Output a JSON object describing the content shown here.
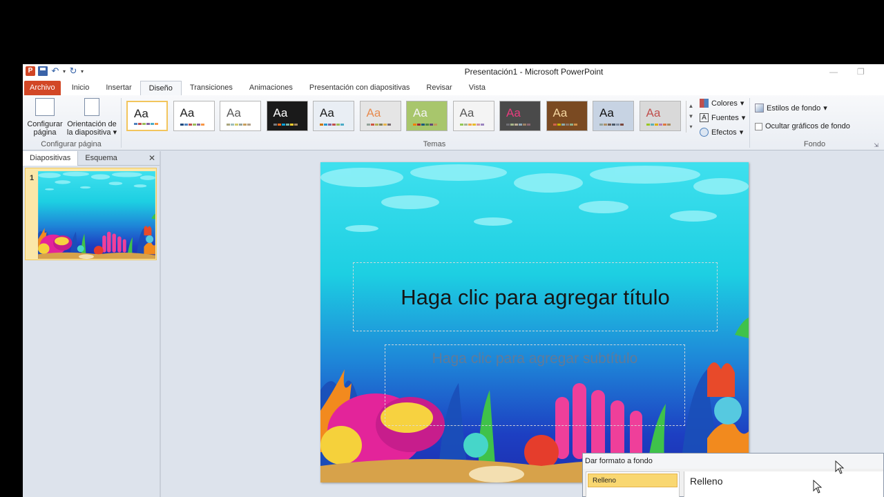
{
  "window": {
    "title": "Presentación1 - Microsoft PowerPoint"
  },
  "ribbon_tabs": [
    {
      "label": "Archivo",
      "type": "file"
    },
    {
      "label": "Inicio"
    },
    {
      "label": "Insertar"
    },
    {
      "label": "Diseño",
      "active": true
    },
    {
      "label": "Transiciones"
    },
    {
      "label": "Animaciones"
    },
    {
      "label": "Presentación con diapositivas"
    },
    {
      "label": "Revisar"
    },
    {
      "label": "Vista"
    }
  ],
  "page_setup": {
    "setup_label_1": "Configurar",
    "setup_label_2": "página",
    "orientation_label_1": "Orientación de",
    "orientation_label_2": "la diapositiva",
    "group_label": "Configurar página"
  },
  "themes": {
    "group_label": "Temas",
    "sample": "Aa",
    "items": [
      {
        "name": "office",
        "bg": "#ffffff",
        "fg": "#222222",
        "selected": true,
        "colors": [
          "#4f81bd",
          "#c0504d",
          "#9bbb59",
          "#8064a2",
          "#4bacc6",
          "#f79646"
        ]
      },
      {
        "name": "plain",
        "bg": "#ffffff",
        "fg": "#222222",
        "colors": [
          "#1f497d",
          "#4f81bd",
          "#c0504d",
          "#9bbb59",
          "#8064a2",
          "#f79646"
        ]
      },
      {
        "name": "adjacency",
        "bg": "#ffffff",
        "fg": "#5a5a5a",
        "colors": [
          "#a9a57c",
          "#9cbebd",
          "#d2cb6c",
          "#95a39d",
          "#c89f5d",
          "#b1a089"
        ]
      },
      {
        "name": "angles",
        "bg": "#1a1a1a",
        "fg": "#ffffff",
        "colors": [
          "#797b7e",
          "#f96a1b",
          "#08a1d9",
          "#7cb5a6",
          "#fbcf2e",
          "#a88963"
        ]
      },
      {
        "name": "apex",
        "bg": "#e9eef4",
        "fg": "#1c1c1c",
        "colors": [
          "#ce7500",
          "#2696cf",
          "#8064a2",
          "#c0504d",
          "#9bbb59",
          "#4bacc6"
        ]
      },
      {
        "name": "apothecary",
        "bg": "#e5e5e5",
        "fg": "#e78b4f",
        "colors": [
          "#93a299",
          "#cf543f",
          "#b5ae53",
          "#848058",
          "#e8b54d",
          "#786c71"
        ]
      },
      {
        "name": "aspect",
        "bg": "#a8c66c",
        "fg": "#f4f4f4",
        "colors": [
          "#f07f09",
          "#9f2936",
          "#1b587c",
          "#4e8542",
          "#604878",
          "#c19859"
        ]
      },
      {
        "name": "austin",
        "bg": "#f4f4f4",
        "fg": "#595959",
        "colors": [
          "#94c954",
          "#a5b592",
          "#f3a447",
          "#e7bc29",
          "#d092a7",
          "#9c85c0"
        ]
      },
      {
        "name": "black-tie",
        "bg": "#4a4a4a",
        "fg": "#e83c7e",
        "colors": [
          "#6f6f74",
          "#a7b789",
          "#beae98",
          "#92a9b9",
          "#9c8265",
          "#8d6974"
        ]
      },
      {
        "name": "civic",
        "bg": "#7a4a22",
        "fg": "#f5d6a0",
        "colors": [
          "#d16349",
          "#ccb400",
          "#8cadae",
          "#8c7b70",
          "#8fb08c",
          "#d19049"
        ]
      },
      {
        "name": "clarity",
        "bg": "#c7d3e3",
        "fg": "#111111",
        "colors": [
          "#93a299",
          "#ad8f67",
          "#726056",
          "#4c5a6a",
          "#808da0",
          "#79463d"
        ]
      },
      {
        "name": "composite",
        "bg": "#d9d9d9",
        "fg": "#c0504d",
        "colors": [
          "#98c723",
          "#59b0b9",
          "#deae00",
          "#b77bb4",
          "#e0773c",
          "#a98d63"
        ]
      }
    ]
  },
  "design_cmds": {
    "colors": "Colores",
    "fonts": "Fuentes",
    "effects": "Efectos"
  },
  "background": {
    "styles": "Estilos de fondo",
    "hide_graphics": "Ocultar gráficos de fondo",
    "group_label": "Fondo"
  },
  "left_pane": {
    "tabs": [
      "Diapositivas",
      "Esquema"
    ],
    "slide_number": "1"
  },
  "slide": {
    "title_placeholder": "Haga clic para agregar título",
    "subtitle_placeholder": "Haga clic para agregar subtítulo"
  },
  "format_dialog": {
    "title": "Dar formato a fondo",
    "selected_item": "Relleno",
    "section_heading": "Relleno"
  }
}
